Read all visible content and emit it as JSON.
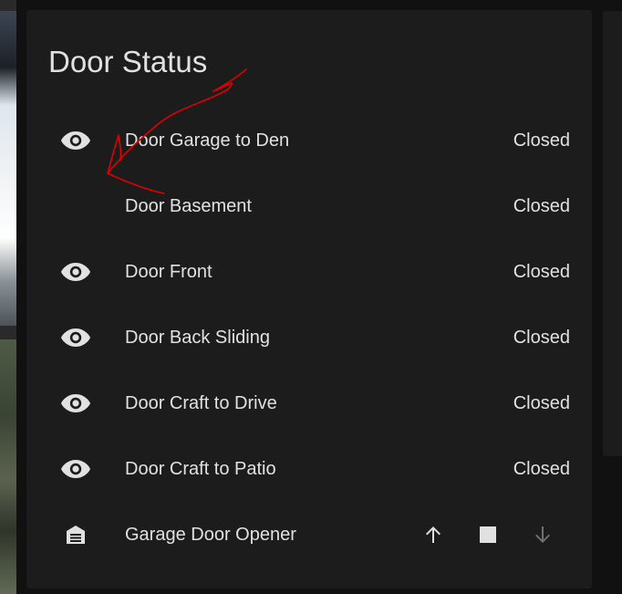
{
  "card": {
    "title": "Door Status"
  },
  "rows": [
    {
      "label": "Door Garage to Den",
      "state": "Closed",
      "icon": "eye-icon"
    },
    {
      "label": "Door Basement",
      "state": "Closed",
      "icon": ""
    },
    {
      "label": "Door Front",
      "state": "Closed",
      "icon": "eye-icon"
    },
    {
      "label": "Door Back Sliding",
      "state": "Closed",
      "icon": "eye-icon"
    },
    {
      "label": "Door Craft to Drive",
      "state": "Closed",
      "icon": "eye-icon"
    },
    {
      "label": "Door Craft to Patio",
      "state": "Closed",
      "icon": "eye-icon"
    }
  ],
  "garage": {
    "label": "Garage Door Opener",
    "icon": "garage-icon",
    "controls": [
      "open-arrow-up-icon",
      "stop-square-icon",
      "close-arrow-down-icon"
    ]
  },
  "colors": {
    "card_background": "#1c1c1c",
    "page_background": "#111111",
    "text": "#e1e1e1",
    "disabled_control": "#6f6f6f",
    "annotation_stroke": "#e00000"
  }
}
